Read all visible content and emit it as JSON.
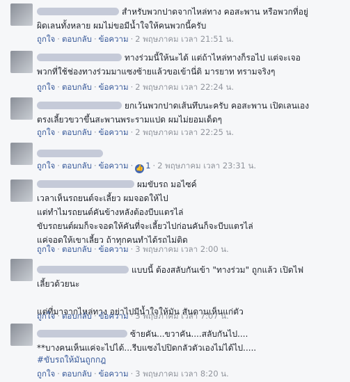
{
  "actions": {
    "like": "ถูกใจ",
    "reply": "ตอบกลับ",
    "message": "ข้อความ"
  },
  "comments": [
    {
      "text": "สำหรับพวกปาดจากไหล่ทาง คอสะพาน หรือพวกที่อยู่\nผิดเลนทั้งหลาย ผมไม่ขอมีน้ำใจให้คนพวกนี้ครับ",
      "time": "2 พฤษภาคม เวลา 21:51 น."
    },
    {
      "text": "ทางร่วมนี้ให้นะได้ แต่ถ้าไหล่ทางก็รอไป แต่จะเจอ\nพวกที่ใช้ช่องทางร่วมมาแซงซ้ายแล้วขอเข้านี่ดิ มารยาท ทรามจริงๆ",
      "time": "2 พฤษภาคม เวลา 22:24 น."
    },
    {
      "text": "ยกเว้นพวกปาดเส้นทึบนะครับ คอสะพาน เปิดเลนเอง\nตรงเลี้ยวขวาขึ้นสะพานพระรามแปด ผมไม่ยอมเด็ดๆ",
      "time": "2 พฤษภาคม เวลา 22:25 น."
    },
    {
      "text": "",
      "like_count": "1",
      "time": "2 พฤษภาคม เวลา 23:31 น."
    },
    {
      "text": "ผมขับรถ มอไซค์\nเวลาเห็นรถยนต์จะเลี้ยว ผมจอดให้ไป\nแต่ทำไมรถยนต์คันข้างหลังต้องบีบแตรไล่\nขับรถยนต์ผมก็จะจอดให้คันที่จะเลี้ยวไปก่อนคันก็จะบีบแตรไล่\nแค่จอดให้เขาเลี้ยว ถ้าทุกคนทำได้รถไม่ติด",
      "time": "3 พฤษภาคม เวลา 2:00 น."
    },
    {
      "text": "แบบนี้ ต้องสลับกันเข้า \"ทางร่วม\" ถูกแล้ว เปิดไฟ\nเลี้ยวด้วยนะ\n\nแต่ที่มาจากไหล่ทาง อย่าไปมีน้ำใจให้มัน สันดานเห็นแก่ตัว",
      "time": "3 พฤษภาคม เวลา 7:07 น."
    },
    {
      "text": "ซ้ายคัน...ขวาคัน....สลับกันไป....\n**บางคนเห็นแค่จะไปได้...รีบแซงไปปิดกลัวตัวเองไม่ได้ไป.....",
      "hashtag": "#ขับรถให้มันถูกกฎ",
      "time": "3 พฤษภาคม เวลา 8:20 น."
    }
  ]
}
